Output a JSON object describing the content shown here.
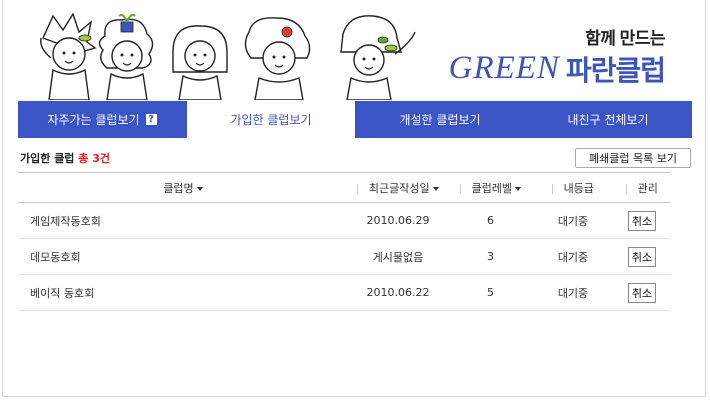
{
  "banner": {
    "slogan": "함께 만드는",
    "brand_green": "GREEN",
    "brand_korean": "파란클럽"
  },
  "tabs": [
    {
      "label": "자주가는 클럽보기",
      "help": "?"
    },
    {
      "label": "가입한 클럽보기",
      "active": true
    },
    {
      "label": "개설한 클럽보기"
    },
    {
      "label": "내친구 전체보기"
    }
  ],
  "summary": {
    "prefix": "가입한 클럽",
    "count": "총 3건"
  },
  "closed_clubs_button": "폐쇄클럽 목록 보기",
  "table": {
    "headers": {
      "name": "클럽명",
      "recent": "최근글작성일",
      "level": "클럽레벨",
      "grade": "내등급",
      "manage": "관리"
    },
    "rows": [
      {
        "name": "게임제작동호회",
        "recent": "2010.06.29",
        "level": "6",
        "grade": "대기중",
        "action": "취소"
      },
      {
        "name": "데모동호회",
        "recent": "게시물없음",
        "level": "3",
        "grade": "대기중",
        "action": "취소"
      },
      {
        "name": "베이직 동호회",
        "recent": "2010.06.22",
        "level": "5",
        "grade": "대기중",
        "action": "취소"
      }
    ]
  },
  "colors": {
    "accent": "#3c55c6",
    "count": "#e02020"
  }
}
